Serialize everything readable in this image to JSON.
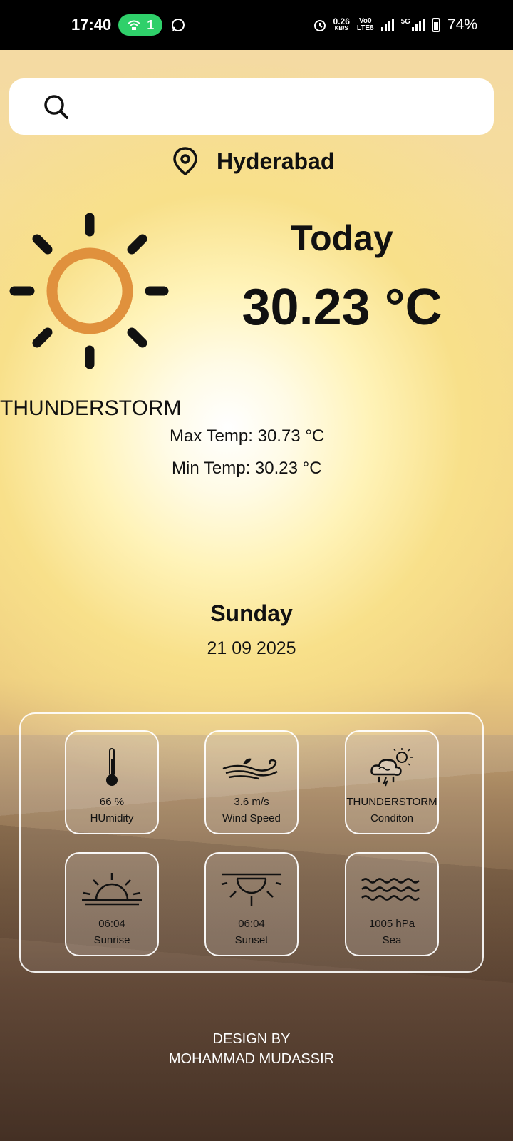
{
  "status_bar": {
    "time": "17:40",
    "hotspot_count": "1",
    "speed_value": "0.26",
    "speed_unit": "KB/S",
    "volte_top": "Vo0",
    "volte_bottom": "LTE8",
    "network": "5G",
    "battery": "74%"
  },
  "search": {
    "placeholder": "",
    "value": ""
  },
  "location": {
    "city": "Hyderabad"
  },
  "weather": {
    "heading": "Today",
    "temperature": "30.23 °C",
    "condition": "THUNDERSTORM",
    "max_temp": "Max Temp: 30.73 °C",
    "min_temp": "Min Temp: 30.23 °C",
    "day": "Sunday",
    "date": "21 09 2025"
  },
  "cards": [
    {
      "icon": "thermometer-icon",
      "value": "66 %",
      "label": "HUmidity"
    },
    {
      "icon": "wind-icon",
      "value": "3.6 m/s",
      "label": "Wind Speed"
    },
    {
      "icon": "storm-cloud-icon",
      "value": "THUNDERSTORM",
      "label": "Conditon"
    },
    {
      "icon": "sunrise-icon",
      "value": "06:04",
      "label": "Sunrise"
    },
    {
      "icon": "sunset-icon",
      "value": "06:04",
      "label": "Sunset"
    },
    {
      "icon": "waves-icon",
      "value": "1005 hPa",
      "label": "Sea"
    }
  ],
  "footer": {
    "line1": "DESIGN BY",
    "line2": "MOHAMMAD MUDASSIR"
  },
  "colors": {
    "sun_ring": "#e0913d",
    "hotspot": "#2fd06a"
  }
}
